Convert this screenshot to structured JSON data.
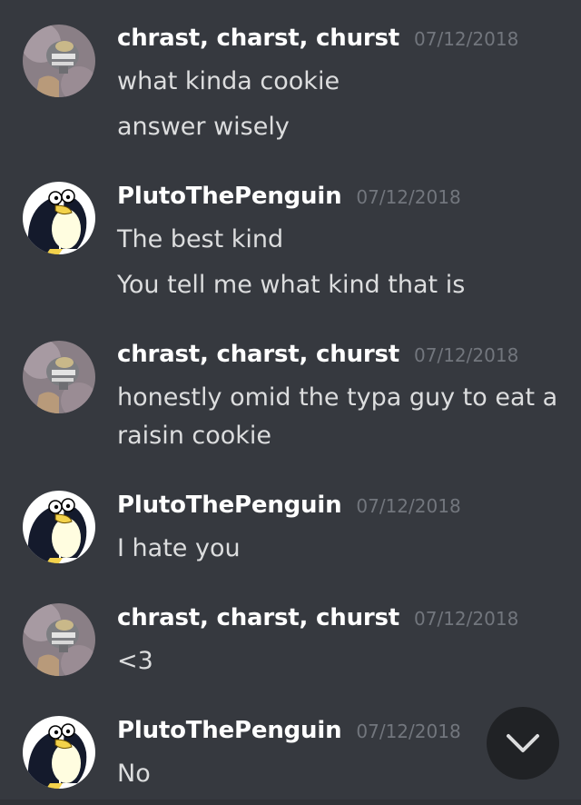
{
  "colors": {
    "background": "#36393f",
    "username": "#ffffff",
    "timestamp": "#72767d",
    "message_text": "#dcddde",
    "scroll_button_bg": "#202225"
  },
  "messages": [
    {
      "avatar_icon": "grey-knit-hat-avatar-icon",
      "username": "chrast, charst, churst",
      "timestamp": "07/12/2018",
      "lines": [
        "what kinda cookie",
        "answer wisely"
      ]
    },
    {
      "avatar_icon": "penguin-avatar-icon",
      "username": "PlutoThePenguin",
      "timestamp": "07/12/2018",
      "lines": [
        "The best kind",
        "You tell me what kind that is"
      ]
    },
    {
      "avatar_icon": "grey-knit-hat-avatar-icon",
      "username": "chrast, charst, churst",
      "timestamp": "07/12/2018",
      "lines": [
        "honestly omid the typa guy to eat a",
        "raisin cookie"
      ]
    },
    {
      "avatar_icon": "penguin-avatar-icon",
      "username": "PlutoThePenguin",
      "timestamp": "07/12/2018",
      "lines": [
        "I hate you"
      ]
    },
    {
      "avatar_icon": "grey-knit-hat-avatar-icon",
      "username": "chrast, charst, churst",
      "timestamp": "07/12/2018",
      "lines": [
        "<3"
      ]
    },
    {
      "avatar_icon": "penguin-avatar-icon",
      "username": "PlutoThePenguin",
      "timestamp": "07/12/2018",
      "lines": [
        "No"
      ]
    }
  ],
  "scroll_button": {
    "icon": "chevron-down-icon"
  }
}
